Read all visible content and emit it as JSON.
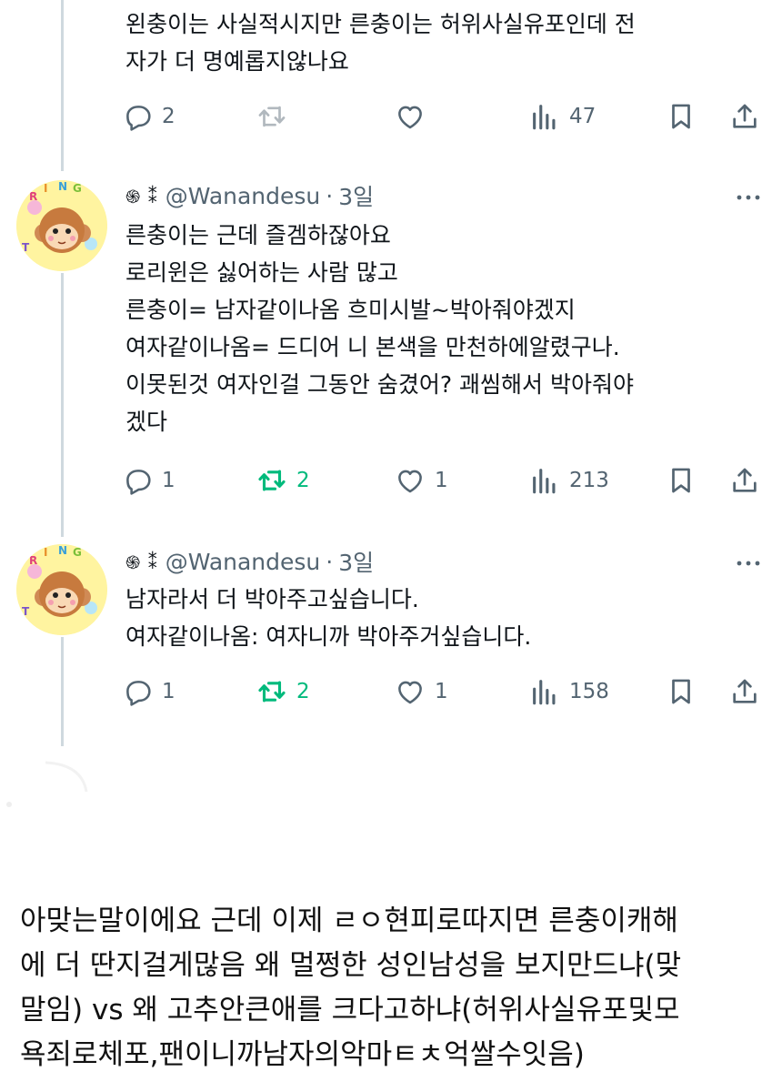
{
  "tweet0": {
    "text": "왼충이는 사실적시지만 른충이는 허위사실유포인데 전\n자가 더 명예롭지않나요",
    "replies": "2",
    "retweets": "",
    "likes": "",
    "views": "47"
  },
  "tweet1": {
    "name_emoji": "֍ ⁑",
    "handle": "@Wanandesu",
    "dot": "·",
    "time": "3일",
    "text": "른충이는 근데 즐겜하잖아요\n로리윈은 싫어하는 사람 많고\n른충이= 남자같이나옴 흐미시발~박아줘야겠지\n여자같이나옴= 드디어 니 본색을 만천하에알렸구나.\n이못된것 여자인걸 그동안 숨겼어? 괘씸해서 박아줘야\n겠다",
    "replies": "1",
    "retweets": "2",
    "likes": "1",
    "views": "213"
  },
  "tweet2": {
    "name_emoji": "֍ ⁑",
    "handle": "@Wanandesu",
    "dot": "·",
    "time": "3일",
    "text": "남자라서 더 박아주고싶습니다.\n여자같이나옴: 여자니까 박아주거싶습니다.",
    "replies": "1",
    "retweets": "2",
    "likes": "1",
    "views": "158"
  },
  "avatar_letters": [
    "R",
    "I",
    "N",
    "G",
    "T"
  ],
  "comment": "아맞는말이에요 근데 이제 ㄹㅇ현피로따지면 른충이캐해\n에 더 딴지걸게많음 왜 멀쩡한 성인남성을 보지만드냐(맞\n말임) vs 왜 고추안큰애를 크다고하냐(허위사실유포및모\n욕죄로체포,팬이니까남자의악마ㅌㅊ억쌀수잇음)",
  "colors": {
    "text": "#0f1419",
    "muted": "#536471",
    "retweet_active": "#00ba7c",
    "thread": "#cfd9de"
  }
}
